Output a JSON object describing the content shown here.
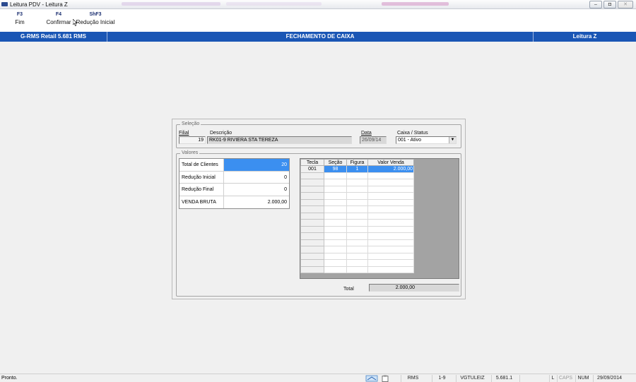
{
  "window": {
    "title": "Leitura PDV - Leitura Z",
    "minimize": "–",
    "maximize": "◘",
    "close": "✕"
  },
  "toolbar": {
    "items": [
      {
        "key": "F3",
        "label": "Fim"
      },
      {
        "key": "F4",
        "label": "Confirmar"
      },
      {
        "key": "ShF3",
        "label": "Redução Inicial"
      }
    ]
  },
  "header": {
    "left": "G-RMS Retail 5.681 RMS",
    "center": "FECHAMENTO DE CAIXA",
    "right": "Leitura Z"
  },
  "selecao": {
    "legend": "Seleção",
    "filial_label": "Filial",
    "filial_value": "19",
    "descricao_label": "Descrição",
    "descricao_value": "RK01-9 RIVIERA STA TEREZA",
    "data_label": "Data",
    "data_value": "26/09/14",
    "caixa_label": "Caixa / Status",
    "caixa_value": "001  - Ativo"
  },
  "valores": {
    "legend": "Valores",
    "rows": [
      {
        "label": "Total de Clientes",
        "value": "20"
      },
      {
        "label": "Redução Inicial",
        "value": "0"
      },
      {
        "label": "Redução Final",
        "value": "0"
      },
      {
        "label": "VENDA BRUTA",
        "value": "2.000,00"
      }
    ]
  },
  "grid": {
    "columns": [
      "Tecla",
      "Seção",
      "Figura",
      "Valor Venda"
    ],
    "rows": [
      {
        "tecla": "001",
        "secao": "98",
        "figura": "1",
        "valor": "2.000,00"
      }
    ],
    "total_label": "Total",
    "total_value": "2.000,00"
  },
  "status": {
    "text": "Pronto.",
    "cells": [
      "RMS",
      "1-9",
      "VGTULEIZ",
      "5.681.1",
      "",
      "L",
      "CAPS",
      "NUM",
      "29/09/2014"
    ]
  }
}
